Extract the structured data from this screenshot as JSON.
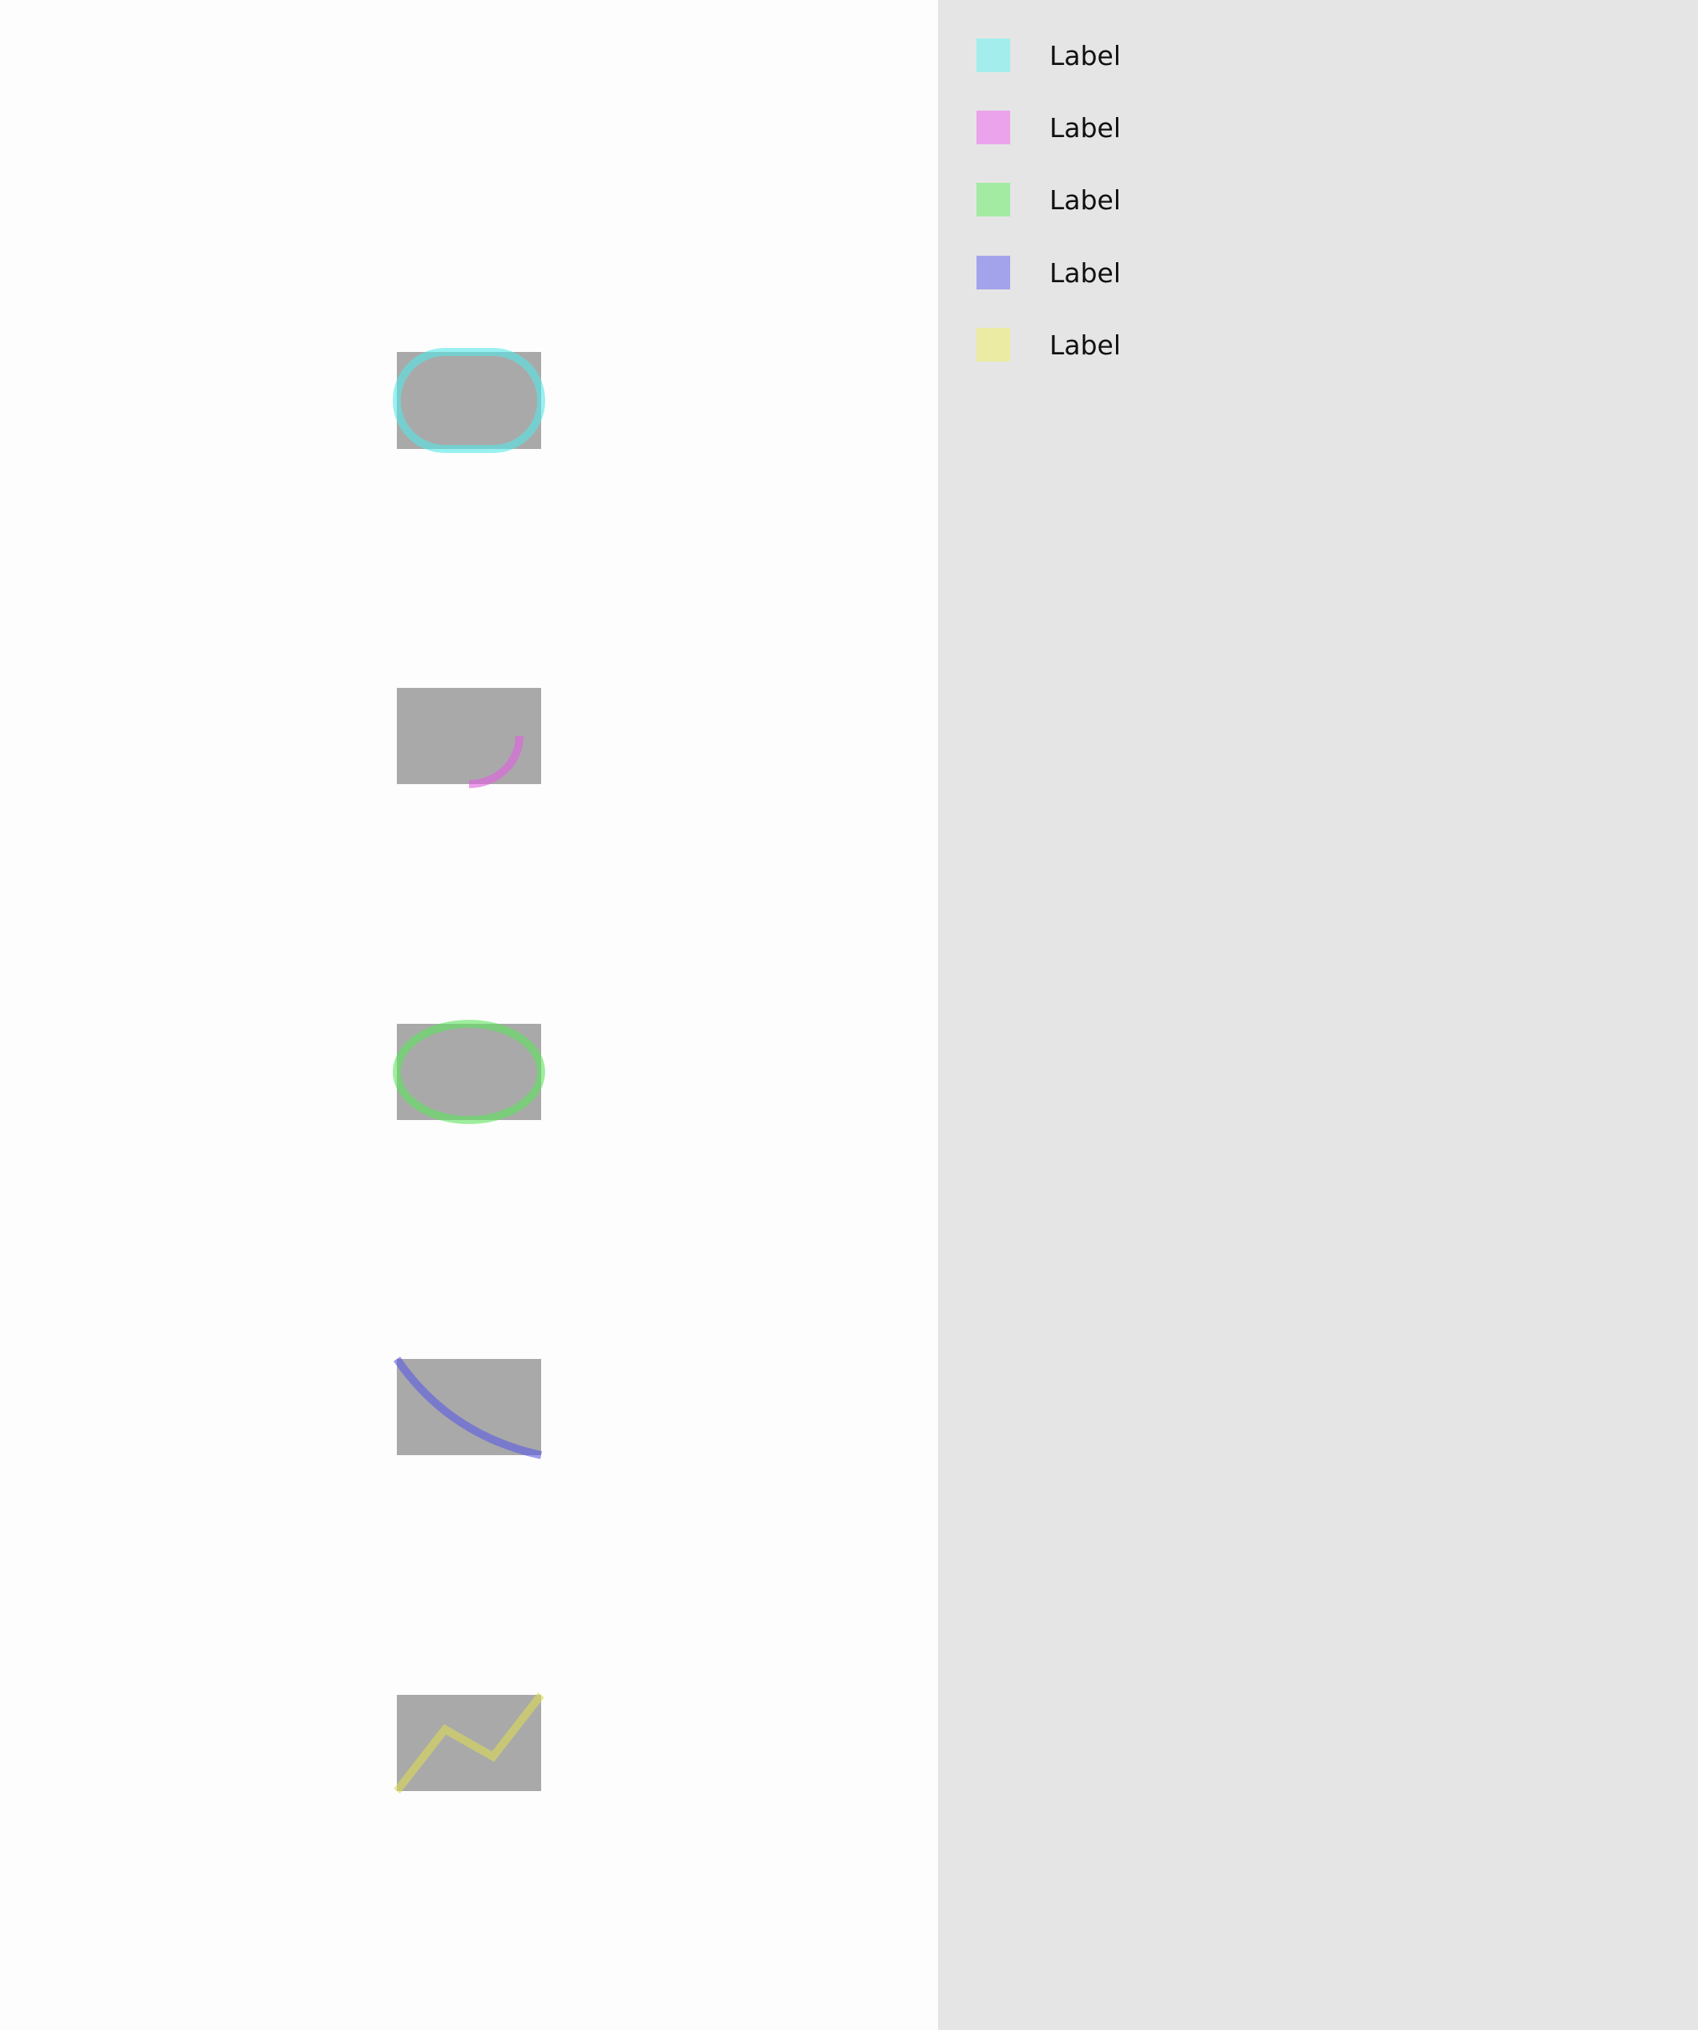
{
  "legend": {
    "items": [
      {
        "label": "Label",
        "color": "#a3eeec"
      },
      {
        "label": "Label",
        "color": "#eba3ec"
      },
      {
        "label": "Label",
        "color": "#a3eba3"
      },
      {
        "label": "Label",
        "color": "#a3a3eb"
      },
      {
        "label": "Label",
        "color": "#ebeba3"
      }
    ]
  },
  "canvas": {
    "box_color": "#a9a9a9",
    "shapes": [
      {
        "name": "rounded-outline-shape",
        "stroke": "#55eae8"
      },
      {
        "name": "corner-arc-shape",
        "stroke": "#e35fe3"
      },
      {
        "name": "ellipse-outline-shape",
        "stroke": "#5ee55e"
      },
      {
        "name": "descending-curve-shape",
        "stroke": "#5c5ce5"
      },
      {
        "name": "zigzag-line-shape",
        "stroke": "#dcdc57"
      }
    ]
  }
}
